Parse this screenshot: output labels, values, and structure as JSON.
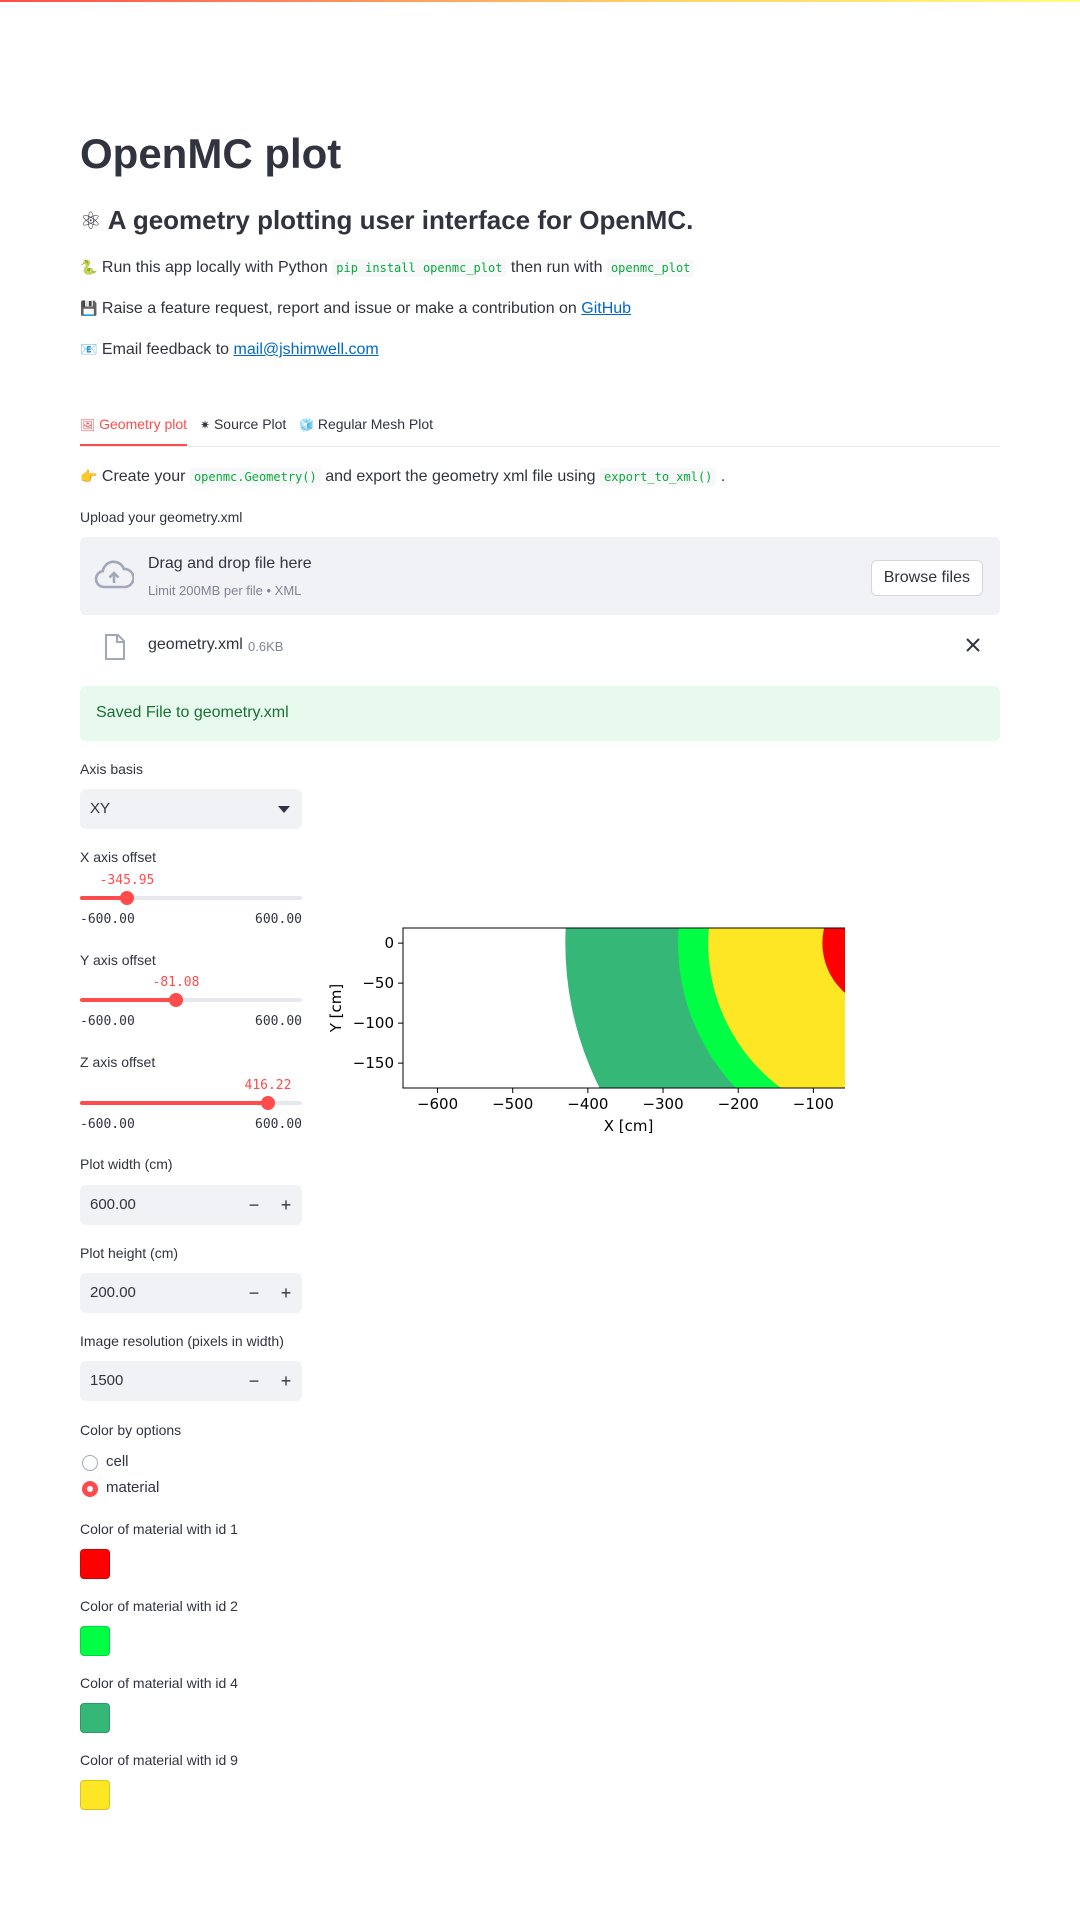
{
  "page": {
    "title": "OpenMC plot",
    "subtitle_icon": "⚛",
    "subtitle": "A geometry plotting user interface for OpenMC.",
    "run_locally": {
      "icon": "🐍",
      "text_before": "Run this app locally with Python",
      "code1": "pip install openmc_plot",
      "text_middle": "then run with",
      "code2": "openmc_plot"
    },
    "feature_request": {
      "icon": "💾",
      "text": "Raise a feature request, report and issue or make a contribution on",
      "link": "GitHub"
    },
    "email": {
      "icon": "📧",
      "text": "Email feedback to",
      "link": "mail@jshimwell.com"
    }
  },
  "tabs": [
    {
      "icon": "🖼",
      "label": "Geometry plot",
      "active": true
    },
    {
      "icon": "✷",
      "label": "Source Plot",
      "active": false
    },
    {
      "icon": "🧊",
      "label": "Regular Mesh Plot",
      "active": false
    }
  ],
  "geometry_tab": {
    "instruction": {
      "icon": "👉",
      "text_before": "Create your",
      "code1": "openmc.Geometry()",
      "text_middle": "and export the geometry xml file using",
      "code2": "export_to_xml()",
      "text_after": "."
    },
    "uploader": {
      "label": "Upload your geometry.xml",
      "drag_text": "Drag and drop file here",
      "limit_text": "Limit 200MB per file • XML",
      "browse_label": "Browse files",
      "file_name": "geometry.xml",
      "file_size": "0.6KB"
    },
    "success_message": "Saved File to geometry.xml",
    "axis_basis": {
      "label": "Axis basis",
      "value": "XY"
    },
    "sliders": [
      {
        "label": "X axis offset",
        "value": "-345.95",
        "min": "-600.00",
        "max": "600.00",
        "fraction": 0.2117
      },
      {
        "label": "Y axis offset",
        "value": "-81.08",
        "min": "-600.00",
        "max": "600.00",
        "fraction": 0.4324
      },
      {
        "label": "Z axis offset",
        "value": "416.22",
        "min": "-600.00",
        "max": "600.00",
        "fraction": 0.8468
      }
    ],
    "plot_width": {
      "label": "Plot width (cm)",
      "value": "600.00"
    },
    "plot_height": {
      "label": "Plot height (cm)",
      "value": "200.00"
    },
    "resolution": {
      "label": "Image resolution (pixels in width)",
      "value": "1500"
    },
    "stepper": {
      "minus": "−",
      "plus": "+"
    },
    "color_by": {
      "label": "Color by options",
      "options": [
        {
          "label": "cell",
          "selected": false
        },
        {
          "label": "material",
          "selected": true
        }
      ]
    },
    "material_colors": [
      {
        "label": "Color of material with id 1",
        "color": "#ff0000"
      },
      {
        "label": "Color of material with id 2",
        "color": "#00ff44"
      },
      {
        "label": "Color of material with id 4",
        "color": "#35b778"
      },
      {
        "label": "Color of material with id 9",
        "color": "#fde725"
      }
    ]
  },
  "chart_data": {
    "type": "heatmap",
    "xlabel": "X [cm]",
    "ylabel": "Y [cm]",
    "xlim": [
      -645.95,
      -45.95
    ],
    "ylim": [
      -181.08,
      18.92
    ],
    "xticks": [
      "−600",
      "−500",
      "−400",
      "−300",
      "−200",
      "−100"
    ],
    "xtick_values": [
      -600,
      -500,
      -400,
      -300,
      -200,
      -100
    ],
    "yticks": [
      "0",
      "−50",
      "−100",
      "−150"
    ],
    "ytick_values": [
      0,
      -50,
      -100,
      -150
    ],
    "regions": [
      {
        "material_id": 4,
        "color": "#35b778",
        "inner_radius_cm": 280,
        "outer_radius_cm": 430
      },
      {
        "material_id": 2,
        "color": "#00ff44",
        "inner_radius_cm": 240,
        "outer_radius_cm": 280
      },
      {
        "material_id": 9,
        "color": "#fde725",
        "inner_radius_cm": 88,
        "outer_radius_cm": 240
      },
      {
        "material_id": 1,
        "color": "#ff0000",
        "inner_radius_cm": 0,
        "outer_radius_cm": 88
      }
    ]
  }
}
